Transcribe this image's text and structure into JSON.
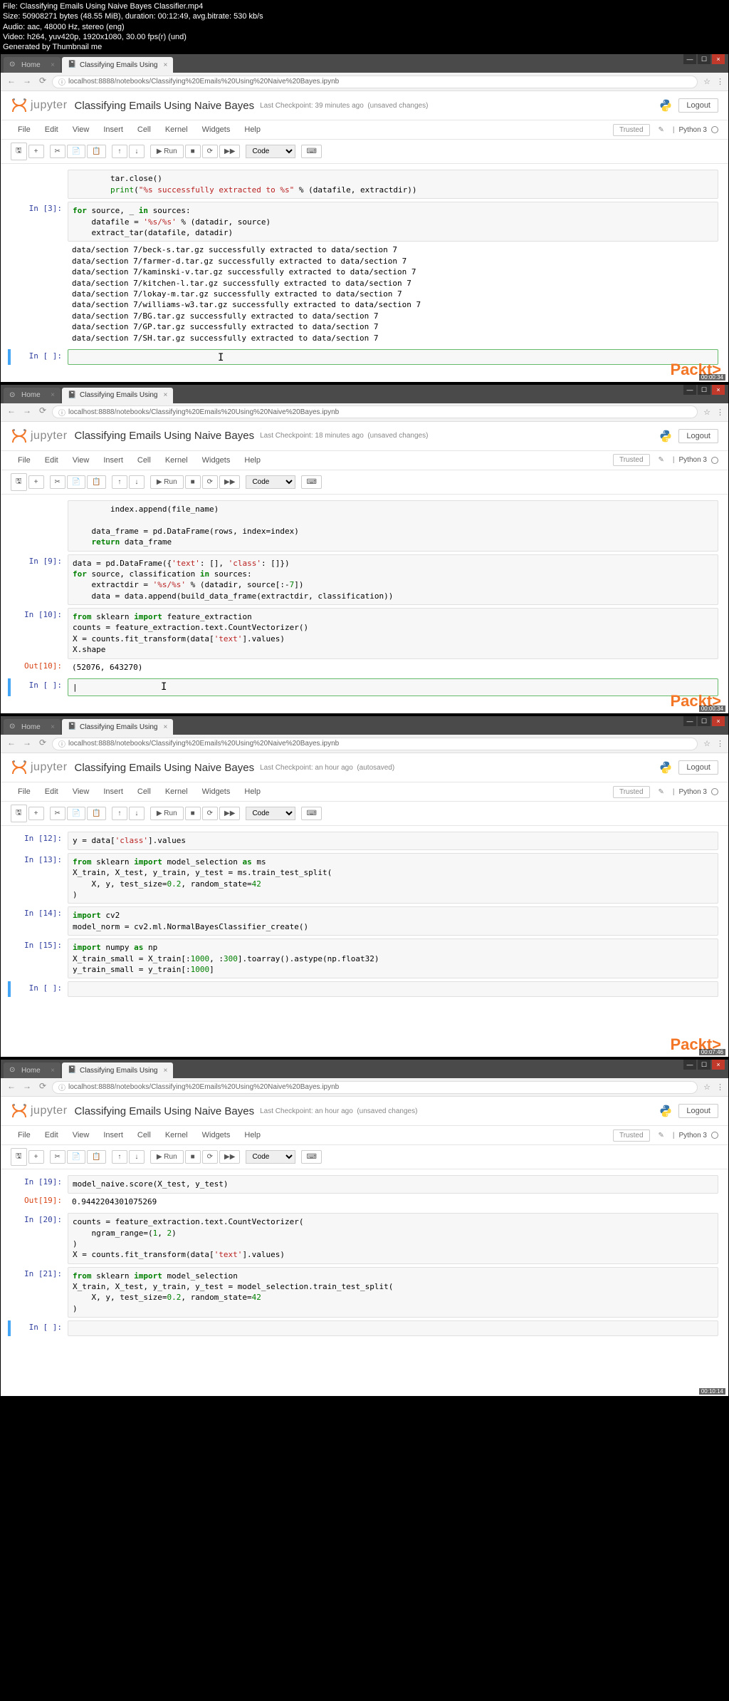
{
  "fileinfo": {
    "l1": "File: Classifying Emails Using Naive Bayes Classifier.mp4",
    "l2": "Size: 50908271 bytes (48.55 MiB), duration: 00:12:49, avg.bitrate: 530 kb/s",
    "l3": "Audio: aac, 48000 Hz, stereo (eng)",
    "l4": "Video: h264, yuv420p, 1920x1080, 30.00 fps(r) (und)",
    "l5": "Generated by Thumbnail me"
  },
  "tabs": {
    "home": "Home",
    "nb": "Classifying Emails Using"
  },
  "url": "localhost:8888/notebooks/Classifying%20Emails%20Using%20Naive%20Bayes.ipynb",
  "jupyter": "jupyter",
  "title": "Classifying Emails Using Naive Bayes",
  "checkpoint1": "Last Checkpoint: 39 minutes ago",
  "checkpoint2": "Last Checkpoint: 18 minutes ago",
  "checkpoint3": "Last Checkpoint: an hour ago",
  "status_unsaved": "(unsaved changes)",
  "status_autosaved": "(autosaved)",
  "logout": "Logout",
  "menu": {
    "file": "File",
    "edit": "Edit",
    "view": "View",
    "insert": "Insert",
    "cell": "Cell",
    "kernel": "Kernel",
    "widgets": "Widgets",
    "help": "Help"
  },
  "trusted": "Trusted",
  "kernel": "Python 3",
  "run": "Run",
  "celltype": "Code",
  "watermark": "Packt>",
  "ts1": "00:00:34",
  "ts2": "00:00:34",
  "ts3": "00:07:46",
  "ts4": "00:10:14",
  "f1": {
    "partial": "        tar.close()\n        print(\"%s successfully extracted to %s\" % (datafile, extractdir))",
    "in3_prompt": "In [3]:",
    "in3_code": "for source, _ in sources:\n    datafile = '%s/%s' % (datadir, source)\n    extract_tar(datafile, datadir)",
    "out3": "data/section 7/beck-s.tar.gz successfully extracted to data/section 7\ndata/section 7/farmer-d.tar.gz successfully extracted to data/section 7\ndata/section 7/kaminski-v.tar.gz successfully extracted to data/section 7\ndata/section 7/kitchen-l.tar.gz successfully extracted to data/section 7\ndata/section 7/lokay-m.tar.gz successfully extracted to data/section 7\ndata/section 7/williams-w3.tar.gz successfully extracted to data/section 7\ndata/section 7/BG.tar.gz successfully extracted to data/section 7\ndata/section 7/GP.tar.gz successfully extracted to data/section 7\ndata/section 7/SH.tar.gz successfully extracted to data/section 7",
    "empty_prompt": "In [ ]:"
  },
  "f2": {
    "partial": "        index.append(file_name)\n\n    data_frame = pd.DataFrame(rows, index=index)\n    return data_frame",
    "in9_prompt": "In [9]:",
    "in9_code": "data = pd.DataFrame({'text': [], 'class': []})\nfor source, classification in sources:\n    extractdir = '%s/%s' % (datadir, source[:-7])\n    data = data.append(build_data_frame(extractdir, classification))",
    "in10_prompt": "In [10]:",
    "in10_code": "from sklearn import feature_extraction\ncounts = feature_extraction.text.CountVectorizer()\nX = counts.fit_transform(data['text'].values)\nX.shape",
    "out10_prompt": "Out[10]:",
    "out10": "(52076, 643270)",
    "empty_prompt": "In [ ]:"
  },
  "f3": {
    "in12_prompt": "In [12]:",
    "in12_code": "y = data['class'].values",
    "in13_prompt": "In [13]:",
    "in13_code": "from sklearn import model_selection as ms\nX_train, X_test, y_train, y_test = ms.train_test_split(\n    X, y, test_size=0.2, random_state=42\n)",
    "in14_prompt": "In [14]:",
    "in14_code": "import cv2\nmodel_norm = cv2.ml.NormalBayesClassifier_create()",
    "in15_prompt": "In [15]:",
    "in15_code": "import numpy as np\nX_train_small = X_train[:1000, :300].toarray().astype(np.float32)\ny_train_small = y_train[:1000]",
    "empty_prompt": "In [ ]:"
  },
  "f4": {
    "in19_prompt": "In [19]:",
    "in19_code": "model_naive.score(X_test, y_test)",
    "out19_prompt": "Out[19]:",
    "out19": "0.9442204301075269",
    "in20_prompt": "In [20]:",
    "in20_code": "counts = feature_extraction.text.CountVectorizer(\n    ngram_range=(1, 2)\n)\nX = counts.fit_transform(data['text'].values)",
    "in21_prompt": "In [21]:",
    "in21_code": "from sklearn import model_selection\nX_train, X_test, y_train, y_test = model_selection.train_test_split(\n    X, y, test_size=0.2, random_state=42\n)",
    "empty_prompt": "In [ ]:"
  }
}
